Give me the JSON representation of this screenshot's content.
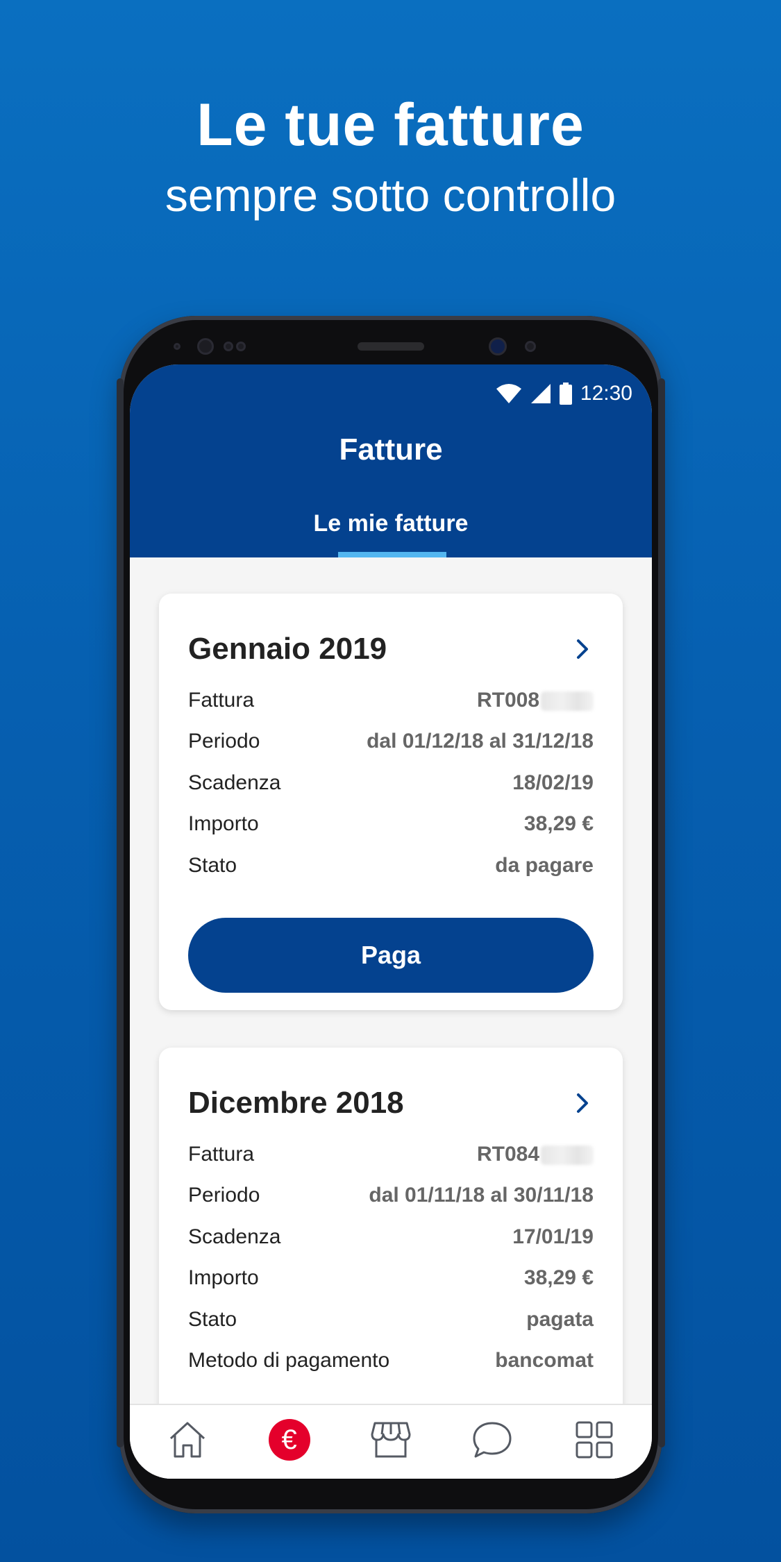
{
  "promo": {
    "headline": "Le tue fatture",
    "subheadline": "sempre sotto controllo"
  },
  "status_bar": {
    "time": "12:30",
    "icons": [
      "wifi-icon",
      "signal-icon",
      "battery-icon"
    ]
  },
  "app_bar": {
    "title": "Fatture",
    "tab_label": "Le mie fatture"
  },
  "invoices": [
    {
      "title": "Gennaio 2019",
      "rows": [
        {
          "label": "Fattura",
          "value": "RT008"
        },
        {
          "label": "Periodo",
          "value": "dal 01/12/18 al 31/12/18"
        },
        {
          "label": "Scadenza",
          "value": "18/02/19"
        },
        {
          "label": "Importo",
          "value": "38,29 €"
        },
        {
          "label": "Stato",
          "value": "da pagare"
        }
      ],
      "pay_button_label": "Paga"
    },
    {
      "title": "Dicembre 2018",
      "rows": [
        {
          "label": "Fattura",
          "value": "RT084"
        },
        {
          "label": "Periodo",
          "value": "dal 01/11/18 al 30/11/18"
        },
        {
          "label": "Scadenza",
          "value": "17/01/19"
        },
        {
          "label": "Importo",
          "value": "38,29 €"
        },
        {
          "label": "Stato",
          "value": "pagata"
        },
        {
          "label": "Metodo di pagamento",
          "value": "bancomat"
        }
      ]
    }
  ],
  "bottom_nav": {
    "items": [
      "home-icon",
      "euro-icon",
      "store-icon",
      "chat-icon",
      "grid-icon"
    ],
    "active": "euro-icon",
    "euro_symbol": "€"
  },
  "colors": {
    "background": "#0a6fc0",
    "app_bar": "#04428f",
    "tab_indicator": "#53b6f0",
    "accent_red": "#e4002b"
  }
}
